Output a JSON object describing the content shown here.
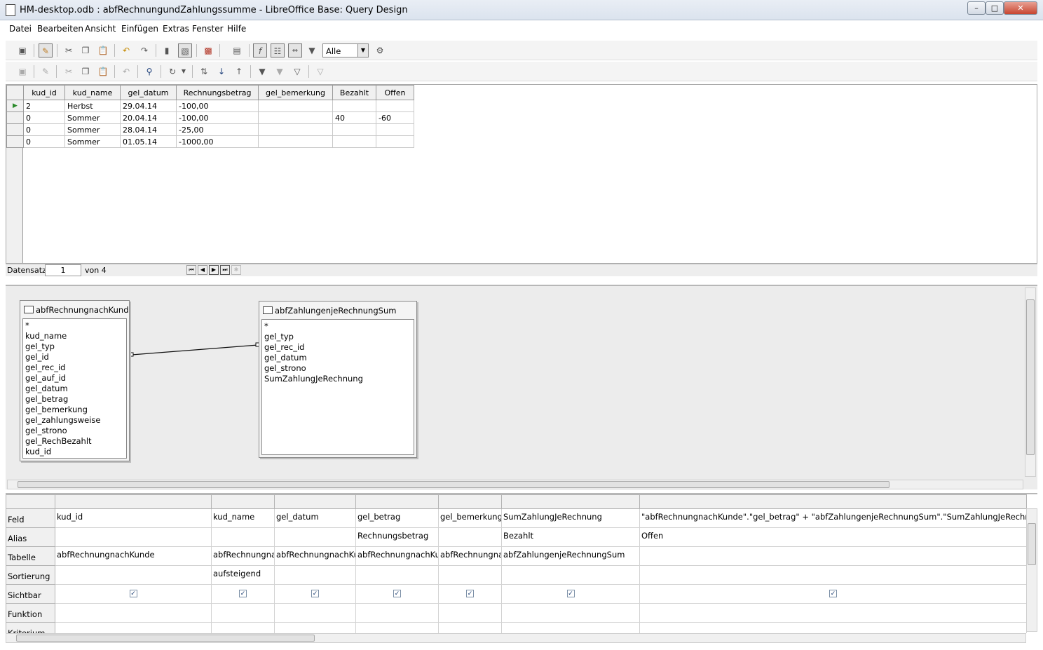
{
  "window": {
    "title": "HM-desktop.odb : abfRechnungundZahlungssumme - LibreOffice Base: Query Design"
  },
  "menu": [
    "Datei",
    "Bearbeiten",
    "Ansicht",
    "Einfügen",
    "Extras",
    "Fenster",
    "Hilfe"
  ],
  "toolbar": {
    "limit_value": "Alle"
  },
  "result": {
    "columns": [
      "kud_id",
      "kud_name",
      "gel_datum",
      "Rechnungsbetrag",
      "gel_bemerkung",
      "Bezahlt",
      "Offen"
    ],
    "rows": [
      [
        "2",
        "Herbst",
        "29.04.14",
        "-100,00",
        "",
        "",
        ""
      ],
      [
        "0",
        "Sommer",
        "20.04.14",
        "-100,00",
        "",
        "40",
        "-60"
      ],
      [
        "0",
        "Sommer",
        "28.04.14",
        "-25,00",
        "",
        "",
        ""
      ],
      [
        "0",
        "Sommer",
        "01.05.14",
        "-1000,00",
        "",
        "",
        ""
      ]
    ]
  },
  "nav": {
    "label": "Datensatz",
    "current": "1",
    "of": "von 4"
  },
  "tables": [
    {
      "name": "abfRechnungnachKunde",
      "fields": [
        "*",
        "kud_name",
        "gel_typ",
        "gel_id",
        "gel_rec_id",
        "gel_auf_id",
        "gel_datum",
        "gel_betrag",
        "gel_bemerkung",
        "gel_zahlungsweise",
        "gel_strono",
        "gel_RechBezahlt",
        "kud_id"
      ]
    },
    {
      "name": "abfZahlungenjeRechnungSum",
      "fields": [
        "*",
        "gel_typ",
        "gel_rec_id",
        "gel_datum",
        "gel_strono",
        "SumZahlungJeRechnung"
      ]
    }
  ],
  "design_grid": {
    "row_labels": [
      "Feld",
      "Alias",
      "Tabelle",
      "Sortierung",
      "Sichtbar",
      "Funktion",
      "Kriterium"
    ],
    "columns": [
      {
        "feld": "kud_id",
        "alias": "",
        "tabelle": "abfRechnungnachKunde",
        "sort": "",
        "visible": true
      },
      {
        "feld": "kud_name",
        "alias": "",
        "tabelle": "abfRechnungnachKunde",
        "sort": "aufsteigend",
        "visible": true
      },
      {
        "feld": "gel_datum",
        "alias": "",
        "tabelle": "abfRechnungnachKunde",
        "sort": "",
        "visible": true
      },
      {
        "feld": "gel_betrag",
        "alias": "Rechnungsbetrag",
        "tabelle": "abfRechnungnachKunde",
        "sort": "",
        "visible": true
      },
      {
        "feld": "gel_bemerkung",
        "alias": "",
        "tabelle": "abfRechnungnachKunde",
        "sort": "",
        "visible": true
      },
      {
        "feld": "SumZahlungJeRechnung",
        "alias": "Bezahlt",
        "tabelle": "abfZahlungenjeRechnungSum",
        "sort": "",
        "visible": true
      },
      {
        "feld": "\"abfRechnungnachKunde\".\"gel_betrag\" + \"abfZahlungenjeRechnungSum\".\"SumZahlungJeRechnung\"",
        "alias": "Offen",
        "tabelle": "",
        "sort": "",
        "visible": true
      }
    ]
  }
}
